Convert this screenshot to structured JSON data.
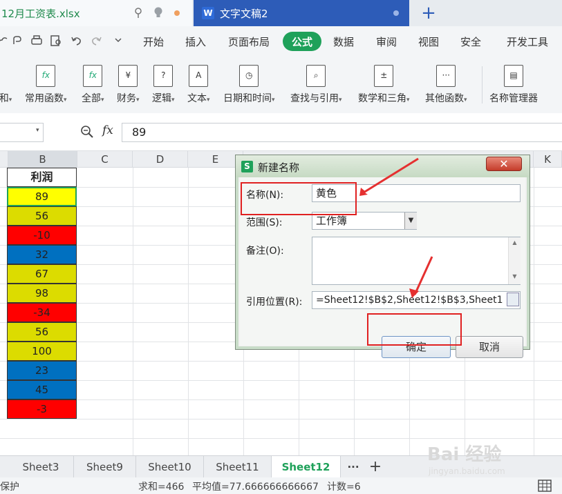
{
  "tabs": {
    "file_tab": "12月工资表.xlsx",
    "doc_tab": "文字文稿2",
    "doc_tab_icon": "W",
    "new_tab": "+"
  },
  "menu": {
    "items": [
      "开始",
      "插入",
      "页面布局",
      "公式",
      "数据",
      "审阅",
      "视图",
      "安全",
      "开发工具"
    ],
    "active": "公式"
  },
  "ribbon": {
    "items": [
      {
        "label": "和",
        "icon": "sum-icon"
      },
      {
        "label": "常用函数",
        "icon": "common-function-icon"
      },
      {
        "label": "全部",
        "icon": "fx-all-icon"
      },
      {
        "label": "财务",
        "icon": "finance-icon"
      },
      {
        "label": "逻辑",
        "icon": "logic-icon"
      },
      {
        "label": "文本",
        "icon": "text-icon"
      },
      {
        "label": "日期和时间",
        "icon": "clock-icon"
      },
      {
        "label": "查找与引用",
        "icon": "lookup-icon"
      },
      {
        "label": "数学和三角",
        "icon": "math-icon"
      },
      {
        "label": "其他函数",
        "icon": "more-function-icon"
      },
      {
        "label": "名称管理器",
        "icon": "name-manager-icon"
      }
    ]
  },
  "formula_bar": {
    "fx": "fx",
    "value": "89"
  },
  "columns": [
    "B",
    "C",
    "D",
    "E",
    "K"
  ],
  "sheet": {
    "header": "利润",
    "cells": [
      {
        "value": "89",
        "color": "#ffff00"
      },
      {
        "value": "56",
        "color": "#dcdc00"
      },
      {
        "value": "-10",
        "color": "#ff0000"
      },
      {
        "value": "32",
        "color": "#0070c0"
      },
      {
        "value": "67",
        "color": "#dcdc00"
      },
      {
        "value": "98",
        "color": "#dcdc00"
      },
      {
        "value": "-34",
        "color": "#ff0000"
      },
      {
        "value": "56",
        "color": "#dcdc00"
      },
      {
        "value": "100",
        "color": "#dcdc00"
      },
      {
        "value": "23",
        "color": "#0070c0"
      },
      {
        "value": "45",
        "color": "#0070c0"
      },
      {
        "value": "-3",
        "color": "#ff0000"
      }
    ]
  },
  "sheet_tabs": [
    "Sheet3",
    "Sheet9",
    "Sheet10",
    "Sheet11",
    "Sheet12"
  ],
  "active_sheet": "Sheet12",
  "sheet_more": "···",
  "sheet_add": "+",
  "status": {
    "left": "保护",
    "sum": "求和=466",
    "avg": "平均值=77.666666666667",
    "count": "计数=6"
  },
  "dialog": {
    "title": "新建名称",
    "close": "✕",
    "name_label": "名称(N):",
    "name_value": "黄色",
    "scope_label": "范围(S):",
    "scope_value": "工作簿",
    "comment_label": "备注(O):",
    "ref_label": "引用位置(R):",
    "ref_value": "=Sheet12!$B$2,Sheet12!$B$3,Sheet1",
    "ok": "确定",
    "cancel": "取消"
  },
  "watermark": {
    "main": "Bai 经验",
    "sub": "jingyan.baidu.com"
  }
}
